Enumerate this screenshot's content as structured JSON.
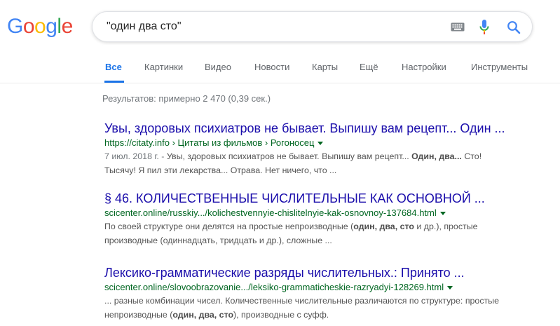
{
  "logo": {
    "letters": [
      "G",
      "o",
      "o",
      "g",
      "l",
      "e"
    ]
  },
  "search": {
    "query": "\"один два сто\""
  },
  "tabs": [
    {
      "label": "Все",
      "active": true
    },
    {
      "label": "Картинки"
    },
    {
      "label": "Видео"
    },
    {
      "label": "Новости"
    },
    {
      "label": "Карты"
    },
    {
      "label": "Ещё"
    },
    {
      "label": "Настройки"
    },
    {
      "label": "Инструменты"
    }
  ],
  "stats": "Результатов: примерно 2 470 (0,39 сек.)",
  "results": [
    {
      "title": "Увы, здоровых психиатров не бывает. Выпишу вам рецепт... Один ...",
      "url": "https://citaty.info › Цитаты из фильмов › Рогоносец",
      "date": "7 июл. 2018 г. - ",
      "snippet_1a": "Увы, здоровых психиатров не бывает. Выпишу вам рецепт... ",
      "snippet_1b": "Один, два...",
      "snippet_1c": " Сто!",
      "snippet_2": "Тысячу! Я пил эти лекарства... Отрава. Нет ничего, что ..."
    },
    {
      "title": "§ 46. КОЛИЧЕСТВЕННЫЕ ЧИСЛИТЕЛЬНЫЕ КАК ОСНОВНОЙ ...",
      "url": "scicenter.online/russkiy.../kolichestvennyie-chislitelnyie-kak-osnovnoy-137684.html",
      "snippet_1a": "По своей структуре они делятся на простые непроизводные (",
      "snippet_1b": "один, два, сто",
      "snippet_1c": " и др.), простые",
      "snippet_2": "производные (одиннадцать, тридцать и др.), сложные ..."
    },
    {
      "title": "Лексико-грамматические разряды числительных.: Принято ...",
      "url": "scicenter.online/slovoobrazovanie.../leksiko-grammaticheskie-razryadyi-128269.html",
      "snippet_1": "... разные комбинации чисел. Количественные числительные различаются по структуре: простые",
      "snippet_2a": "непроизводные (",
      "snippet_2b": "один, два, сто",
      "snippet_2c": "), производные с суфф."
    }
  ],
  "icons": {
    "keyboard": "keyboard-icon",
    "mic": "mic-icon",
    "search": "search-icon",
    "result_menu": "chevron-down-icon"
  },
  "colors": {
    "link": "#1a0dab",
    "url": "#006621",
    "tab_active": "#1a73e8",
    "snippet": "#545454"
  }
}
